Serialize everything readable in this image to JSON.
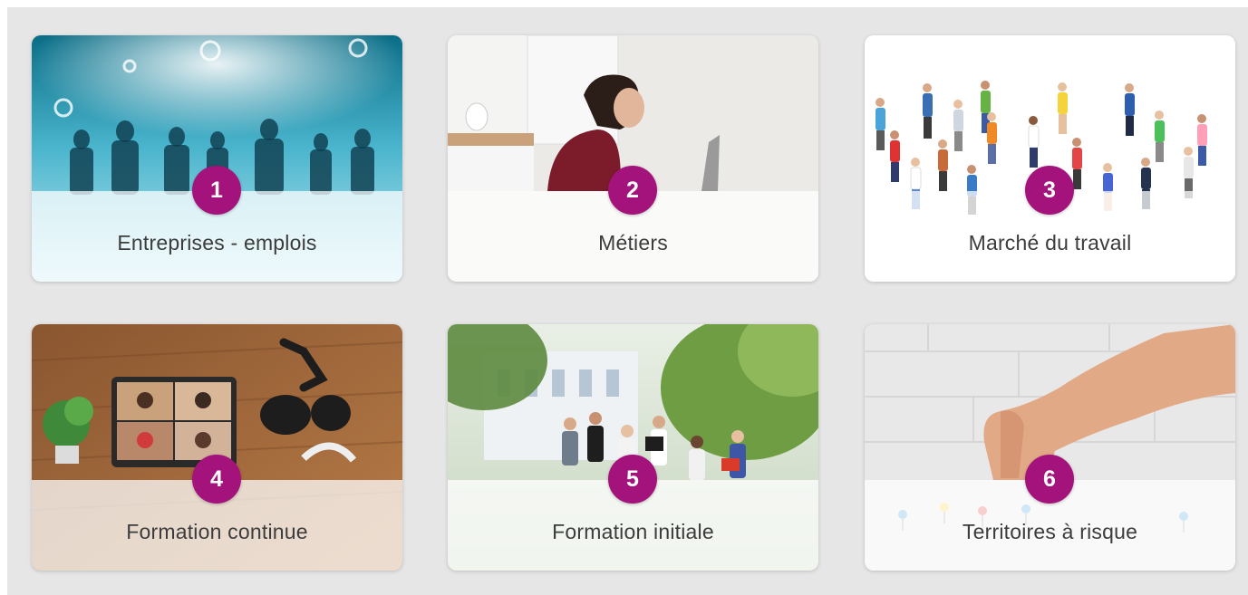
{
  "colors": {
    "background": "#e6e6e6",
    "badge": "#a3137b",
    "label_text": "#3c3c3c"
  },
  "cards": [
    {
      "number": "1",
      "label": "Entreprises - emplois",
      "image": "business-silhouettes-image"
    },
    {
      "number": "2",
      "label": "Métiers",
      "image": "woman-at-laptop-image"
    },
    {
      "number": "3",
      "label": "Marché du travail",
      "image": "crowd-of-people-image"
    },
    {
      "number": "4",
      "label": "Formation continue",
      "image": "video-call-laptop-image"
    },
    {
      "number": "5",
      "label": "Formation initiale",
      "image": "students-walking-image"
    },
    {
      "number": "6",
      "label": "Territoires à risque",
      "image": "hand-pushpin-image"
    }
  ]
}
